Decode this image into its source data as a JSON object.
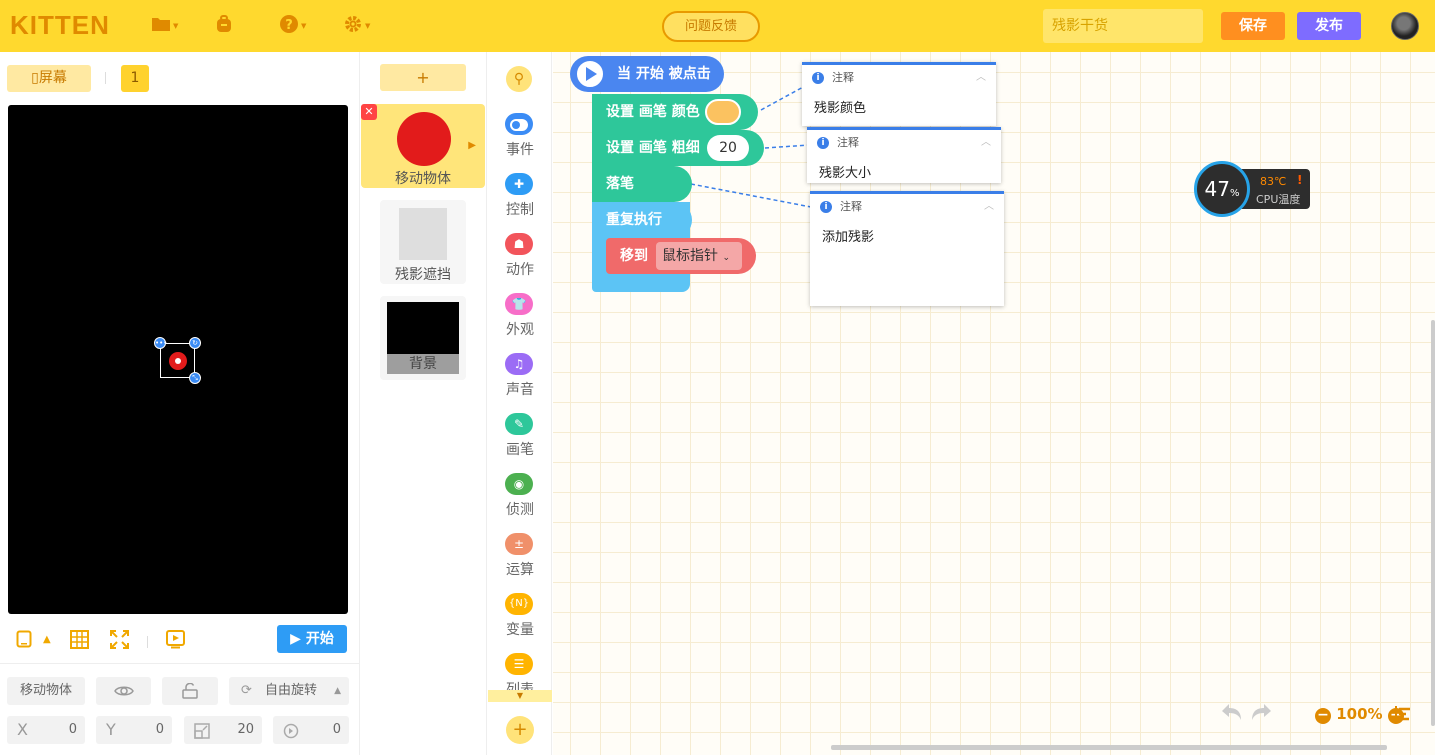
{
  "app": {
    "logo": "KITTEN"
  },
  "topbar": {
    "feedback_label": "问题反馈",
    "project_name": "残影干货",
    "save_label": "保存",
    "publish_label": "发布",
    "icons": [
      "folder-icon",
      "backpack-icon",
      "help-icon",
      "settings-icon"
    ]
  },
  "stage": {
    "screen_label": "屏幕",
    "page_number": "1",
    "start_label": "开始",
    "sprite_name": "移动物体",
    "rotation_label": "自由旋转",
    "x_label": "X",
    "x_value": "0",
    "y_label": "Y",
    "y_value": "0",
    "size_value": "20",
    "direction_value": "0"
  },
  "sprites": {
    "add_label": "+",
    "items": [
      {
        "name": "移动物体",
        "active": true
      },
      {
        "name": "残影遮挡",
        "active": false
      },
      {
        "name": "背景",
        "active": false
      }
    ]
  },
  "categories": [
    {
      "label": "事件",
      "color": "#3b8cf5"
    },
    {
      "label": "控制",
      "color": "#2e9cf5"
    },
    {
      "label": "动作",
      "color": "#f2545b"
    },
    {
      "label": "外观",
      "color": "#f76ec8"
    },
    {
      "label": "声音",
      "color": "#9b6cf5"
    },
    {
      "label": "画笔",
      "color": "#2ec79a"
    },
    {
      "label": "侦测",
      "color": "#4cb050"
    },
    {
      "label": "运算",
      "color": "#f0906a"
    },
    {
      "label": "变量",
      "color": "#ffb400"
    },
    {
      "label": "列表",
      "color": "#ffb400"
    }
  ],
  "blocks": {
    "hat": "当 开始 被点击",
    "set_color": "设置 画笔 颜色",
    "set_width": "设置 画笔 粗细",
    "width_value": "20",
    "pen_down": "落笔",
    "repeat": "重复执行",
    "move_to": "移到",
    "move_target": "鼠标指针",
    "pen_color_hex": "#fbc260"
  },
  "notes": [
    {
      "title": "注释",
      "text": "残影颜色"
    },
    {
      "title": "注释",
      "text": "残影大小"
    },
    {
      "title": "注释",
      "text": "添加残影"
    }
  ],
  "cpu": {
    "percent": "47",
    "unit": "%",
    "temp": "83℃",
    "label": "CPU温度"
  },
  "zoom": {
    "level": "100%"
  }
}
